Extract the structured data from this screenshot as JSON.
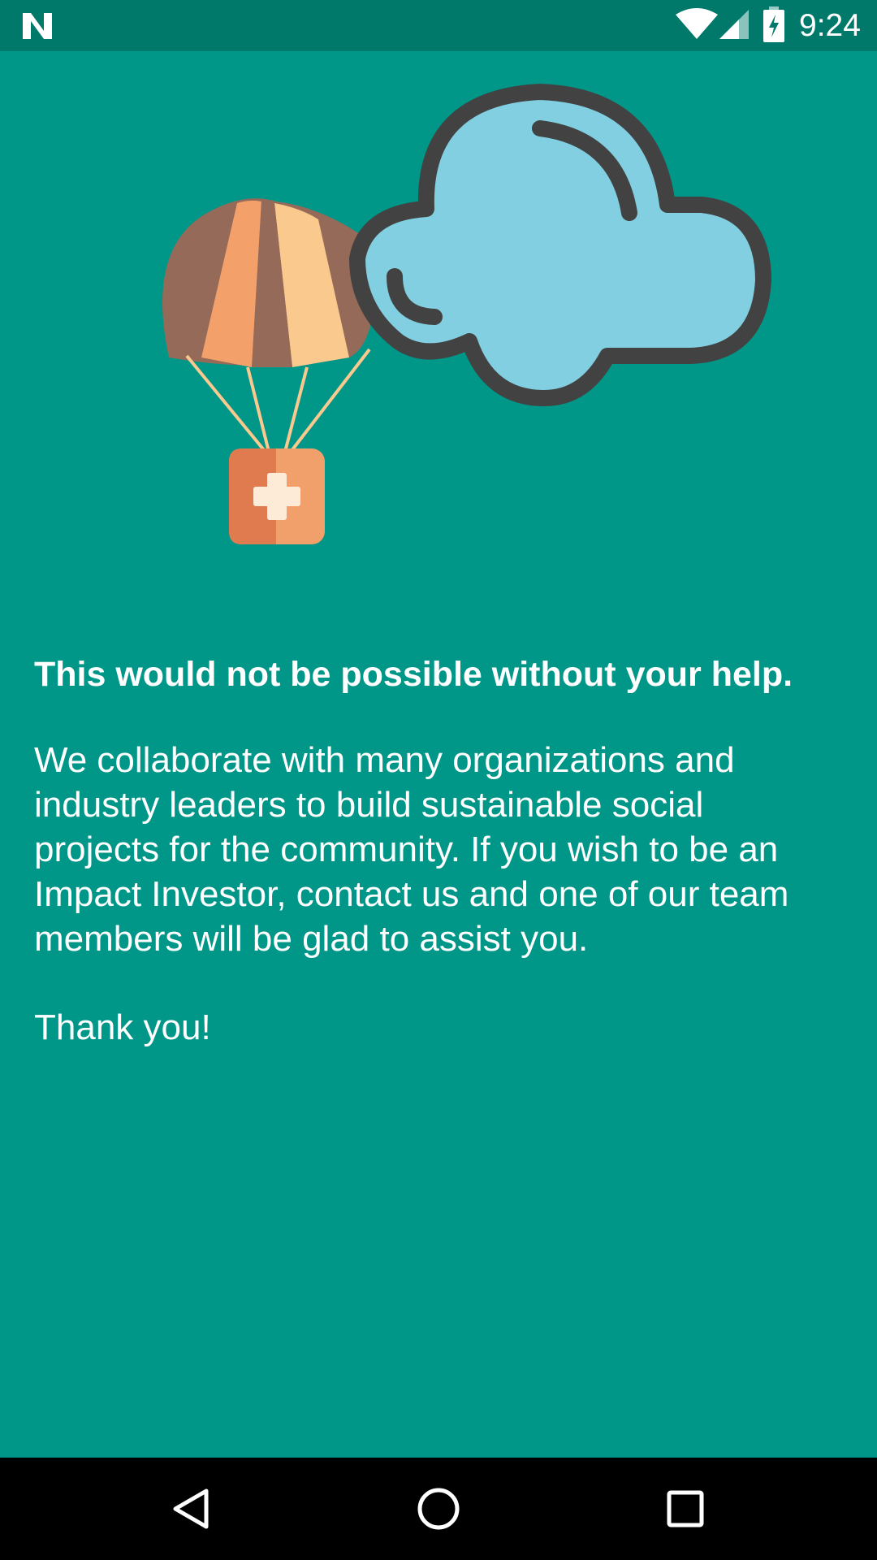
{
  "status_bar": {
    "time": "9:24",
    "icons": [
      "android-n-icon",
      "wifi-icon",
      "cell-signal-icon",
      "battery-charging-icon"
    ]
  },
  "illustration": {
    "icons": [
      "parachute-icon",
      "first-aid-box-icon",
      "cloud-icon"
    ],
    "colors": {
      "cloud_fill": "#81cfe0",
      "cloud_outline": "#424242",
      "parachute_brown": "#956a59",
      "parachute_orange": "#f3a06a",
      "parachute_cream": "#f9c98e",
      "box_dark": "#e07b50",
      "box_light": "#f1a06b"
    }
  },
  "content": {
    "headline": "This would not be possible without your help.",
    "body": "We collaborate with many organizations and industry leaders to build sustainable social projects for the community. If you wish to be an Impact Investor, contact us and one of our team members will be glad to assist you.",
    "closing": "Thank you!"
  },
  "nav_bar": {
    "buttons": [
      "back-icon",
      "home-icon",
      "recents-icon"
    ]
  },
  "theme": {
    "background": "#009688",
    "status_bar": "#00796b",
    "text": "#ffffff"
  }
}
